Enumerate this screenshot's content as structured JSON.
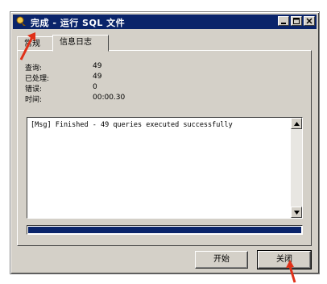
{
  "window": {
    "title": "完成 - 运行 SQL 文件",
    "accent": "#0a246a"
  },
  "title_buttons": [
    "minimize-icon",
    "maximize-icon",
    "close-icon"
  ],
  "tabs": [
    {
      "label": "常规",
      "active": false
    },
    {
      "label": "信息日志",
      "active": true
    }
  ],
  "stats": [
    {
      "label": "查询:",
      "value": "49"
    },
    {
      "label": "已处理:",
      "value": "49"
    },
    {
      "label": "错误:",
      "value": "0"
    },
    {
      "label": "时间:",
      "value": "00:00.30"
    }
  ],
  "log": {
    "text": "[Msg] Finished - 49 queries executed successfully"
  },
  "progress": {
    "fraction": 1.0,
    "color": "#0a246a"
  },
  "buttons": {
    "start_label": "开始",
    "close_label": "关闭"
  },
  "annotation_color": "#e03018"
}
